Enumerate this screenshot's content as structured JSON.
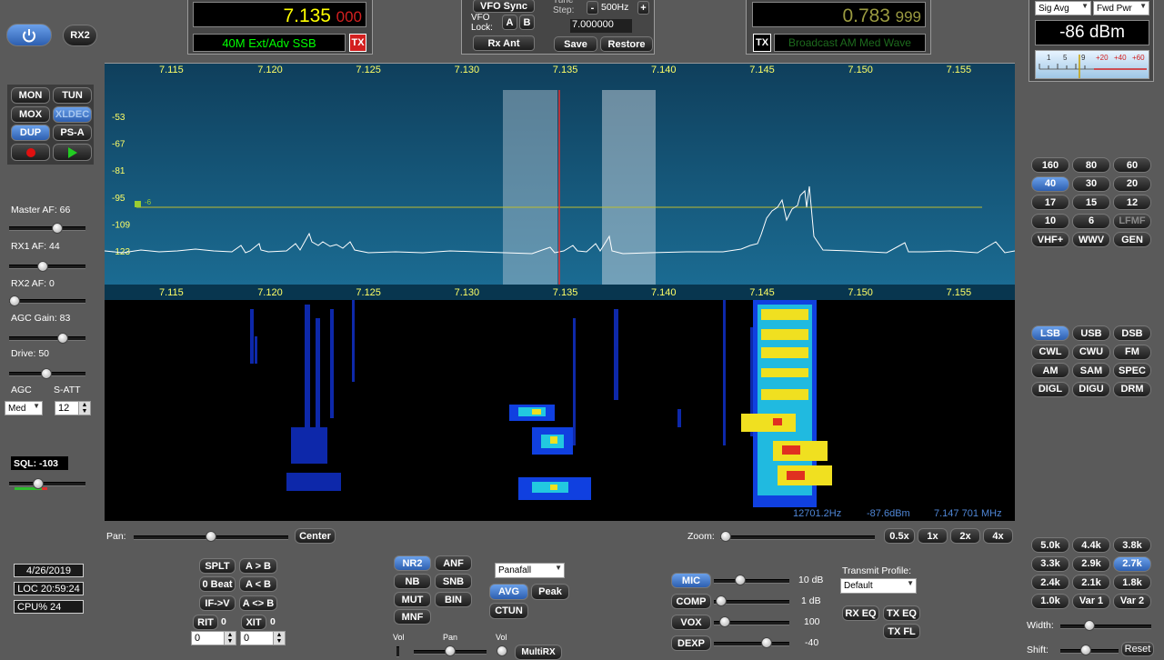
{
  "power_button_icon": "power-icon",
  "rx2_label": "RX2",
  "vfoA": {
    "freq_main": "7.135",
    "freq_sub": "000",
    "band_mode": "40M Ext/Adv SSB",
    "tx": "TX"
  },
  "vfoB": {
    "freq_main": "0.783",
    "freq_sub": "999",
    "band_mode": "Broadcast AM Med Wave",
    "tx": "TX"
  },
  "vfo_center": {
    "sync": "VFO Sync",
    "lock_label": "VFO Lock:",
    "lock_a": "A",
    "lock_b": "B",
    "tune_step_label": "Tune Step:",
    "tune_step_minus": "-",
    "tune_step_value": "500Hz",
    "tune_step_plus": "+",
    "freq_entry": "7.000000",
    "rx_ant": "Rx Ant",
    "save": "Save",
    "restore": "Restore"
  },
  "meter": {
    "mode_left": "Sig Avg",
    "mode_right": "Fwd Pwr",
    "reading": "-86 dBm",
    "scale": [
      "1",
      "5",
      "9",
      "+20",
      "+40",
      "+60"
    ]
  },
  "left_buttons": {
    "mon": "MON",
    "tun": "TUN",
    "mox": "MOX",
    "ctun": "XLDEC",
    "dup": "DUP",
    "psa": "PS-A",
    "record_icon": "record-icon",
    "play_icon": "play-icon"
  },
  "sliders": {
    "master_af": "Master AF:  66",
    "rx1_af": "RX1 AF:  44",
    "rx2_af": "RX2 AF:  0",
    "agc_gain": "AGC Gain:  83",
    "drive": "Drive:  50",
    "agc": "AGC",
    "s_att": "S-ATT",
    "agc_value": "Med",
    "s_att_value": "12",
    "sql": "SQL: -103"
  },
  "status": {
    "date": "4/26/2019",
    "loc": "LOC 20:59:24",
    "cpu": "CPU%  24"
  },
  "spectrum": {
    "freq_ticks": [
      "7.115",
      "7.120",
      "7.125",
      "7.130",
      "7.135",
      "7.140",
      "7.145",
      "7.150",
      "7.155"
    ],
    "db_ticks": [
      "-53",
      "-67",
      "-81",
      "-95",
      "-109",
      "-123"
    ],
    "squelch_marker": "-6",
    "readout_hz": "12701.2Hz",
    "readout_dbm": "-87.6dBm",
    "readout_mhz": "7.147 701 MHz"
  },
  "bands": [
    "160",
    "80",
    "60",
    "40",
    "30",
    "20",
    "17",
    "15",
    "12",
    "10",
    "6",
    "LFMF",
    "VHF+",
    "WWV",
    "GEN"
  ],
  "modes": [
    "LSB",
    "USB",
    "DSB",
    "CWL",
    "CWU",
    "FM",
    "AM",
    "SAM",
    "SPEC",
    "DIGL",
    "DIGU",
    "DRM"
  ],
  "filters": [
    "5.0k",
    "4.4k",
    "3.8k",
    "3.3k",
    "2.9k",
    "2.7k",
    "2.4k",
    "2.1k",
    "1.8k",
    "1.0k",
    "Var 1",
    "Var 2"
  ],
  "filter_sliders": {
    "width": "Width:",
    "shift": "Shift:",
    "reset": "Reset"
  },
  "pan_zoom": {
    "pan": "Pan:",
    "center": "Center",
    "zoom": "Zoom:",
    "z05": "0.5x",
    "z1": "1x",
    "z2": "2x",
    "z4": "4x"
  },
  "vfo_ops": {
    "splt": "SPLT",
    "a_to_b": "A > B",
    "zero_beat": "0 Beat",
    "a_lt_b": "A < B",
    "if_v": "IF->V",
    "a_swap_b": "A <> B",
    "rit": "RIT",
    "rit_val": "0",
    "xit": "XIT",
    "xit_val": "0",
    "rit_spin": "0",
    "xit_spin": "0"
  },
  "dsp": {
    "nr2": "NR2",
    "anf": "ANF",
    "nb": "NB",
    "snb": "SNB",
    "mut": "MUT",
    "bin": "BIN",
    "mnf": "MNF",
    "display_mode": "Panafall",
    "avg": "AVG",
    "peak": "Peak",
    "ctun": "CTUN",
    "vol": "Vol",
    "pan": "Pan",
    "vol2": "Vol",
    "multirx": "MultiRX"
  },
  "tx": {
    "mic": "MIC",
    "mic_val": "10 dB",
    "comp": "COMP",
    "comp_val": "1 dB",
    "vox": "VOX",
    "vox_val": "100",
    "dexp": "DEXP",
    "dexp_val": "-40",
    "profile_label": "Transmit Profile:",
    "profile": "Default",
    "rx_eq": "RX EQ",
    "tx_eq": "TX EQ",
    "tx_fl": "TX FL"
  },
  "colors": {
    "accent": "#4f86d6",
    "vfo_freq": "#ffff00",
    "vfo_sub": "#d32020",
    "band_text": "#00ff00",
    "vfo_b_dim": "#9a9a40"
  }
}
